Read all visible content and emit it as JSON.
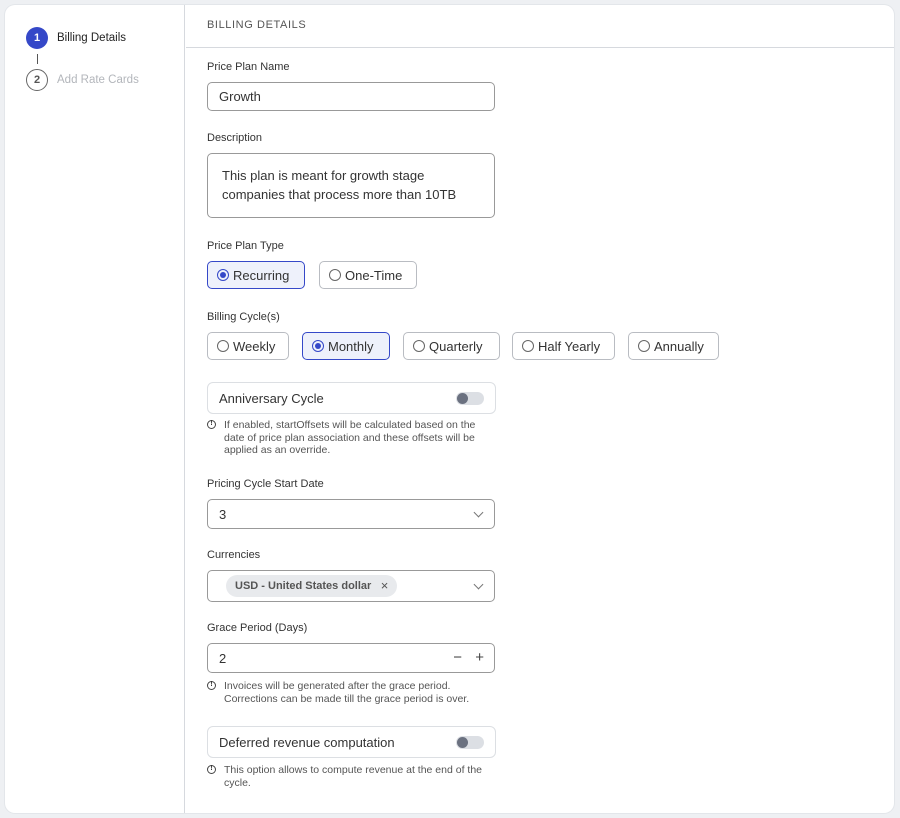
{
  "sidebar": {
    "steps": [
      {
        "number": "1",
        "label": "Billing Details",
        "state": "active"
      },
      {
        "number": "2",
        "label": "Add Rate Cards",
        "state": "inactive"
      }
    ]
  },
  "section_title": "BILLING DETAILS",
  "price_plan_name": {
    "label": "Price Plan Name",
    "value": "Growth"
  },
  "description": {
    "label": "Description",
    "value": "This plan is meant for growth stage companies that process more than 10TB"
  },
  "price_plan_type": {
    "label": "Price Plan Type",
    "options": [
      {
        "label": "Recurring",
        "selected": true
      },
      {
        "label": "One-Time",
        "selected": false
      }
    ]
  },
  "billing_cycles": {
    "label": "Billing Cycle(s)",
    "options": [
      {
        "label": "Weekly",
        "selected": false
      },
      {
        "label": "Monthly",
        "selected": true
      },
      {
        "label": "Quarterly",
        "selected": false
      },
      {
        "label": "Half Yearly",
        "selected": false
      },
      {
        "label": "Annually",
        "selected": false
      }
    ]
  },
  "anniversary_cycle": {
    "label": "Anniversary Cycle",
    "enabled": false,
    "hint": "If enabled, startOffsets will be calculated based on the date of price plan association and these offsets will be applied as an override."
  },
  "pricing_cycle_start_date": {
    "label": "Pricing Cycle Start Date",
    "value": "3"
  },
  "currencies": {
    "label": "Currencies",
    "selected": [
      "USD - United States dollar"
    ]
  },
  "grace_period": {
    "label": "Grace Period (Days)",
    "value": "2",
    "decrement": "−",
    "increment": "+",
    "hint": "Invoices will be generated after the grace period. Corrections can be made till the grace period is over."
  },
  "deferred_revenue": {
    "label": "Deferred revenue computation",
    "enabled": false,
    "hint": "This option allows to compute revenue at the end of the cycle."
  },
  "icons": {
    "info": "!",
    "chip_remove": "×"
  },
  "colors": {
    "accent": "#3548c8",
    "selected_bg": "#eef1fb"
  }
}
